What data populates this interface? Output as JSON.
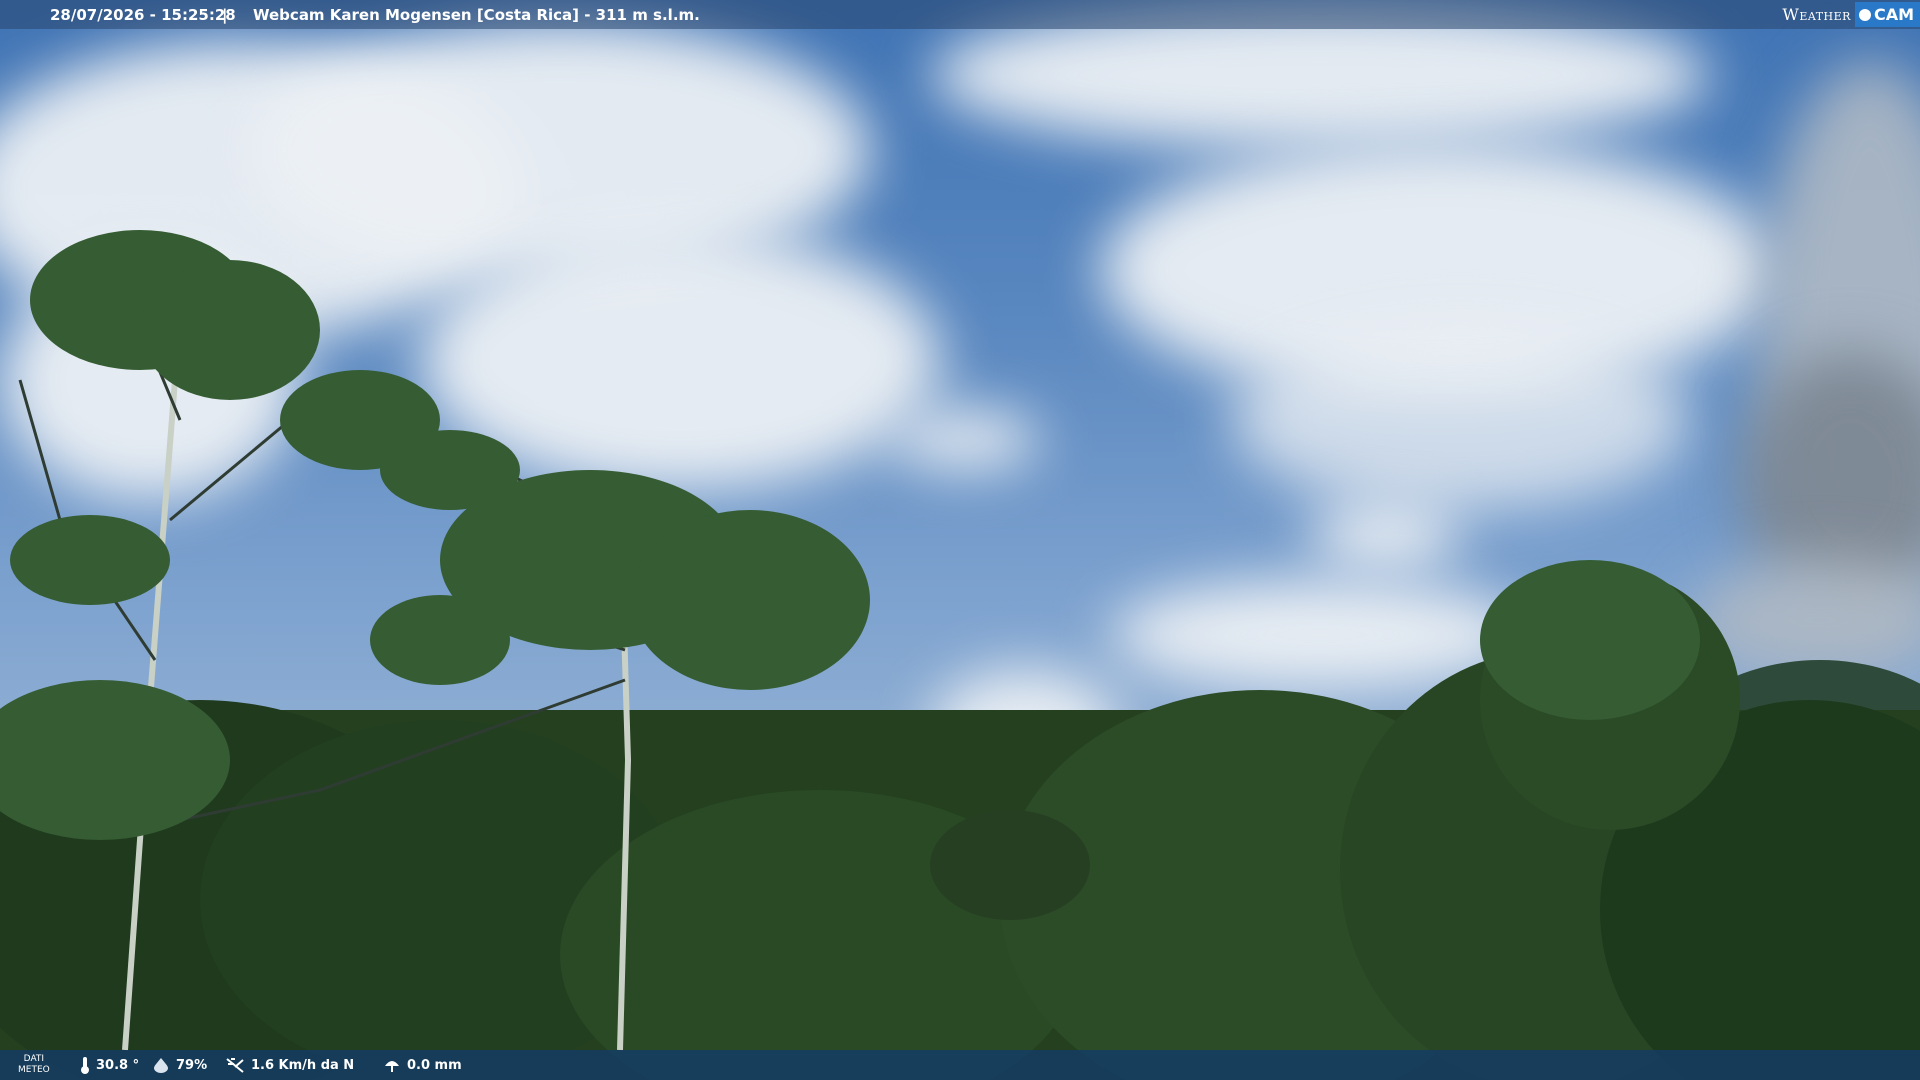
{
  "header": {
    "datetime": "28/07/2026 - 15:25:28",
    "separator": "|",
    "camera_title": "Webcam Karen Mogensen [Costa Rica] - 311 m s.l.m.",
    "brand_weather": "Weather",
    "brand_cam": "CAM"
  },
  "weather": {
    "label_line1": "DATI",
    "label_line2": "METEO",
    "temperature": "30.8 °",
    "humidity": "79%",
    "wind": "1.6 Km/h da N",
    "rain": "0.0 mm"
  },
  "icons": {
    "temperature": "thermometer-icon",
    "humidity": "humidity-drop-icon",
    "wind": "wind-icon",
    "rain": "rain-icon"
  }
}
